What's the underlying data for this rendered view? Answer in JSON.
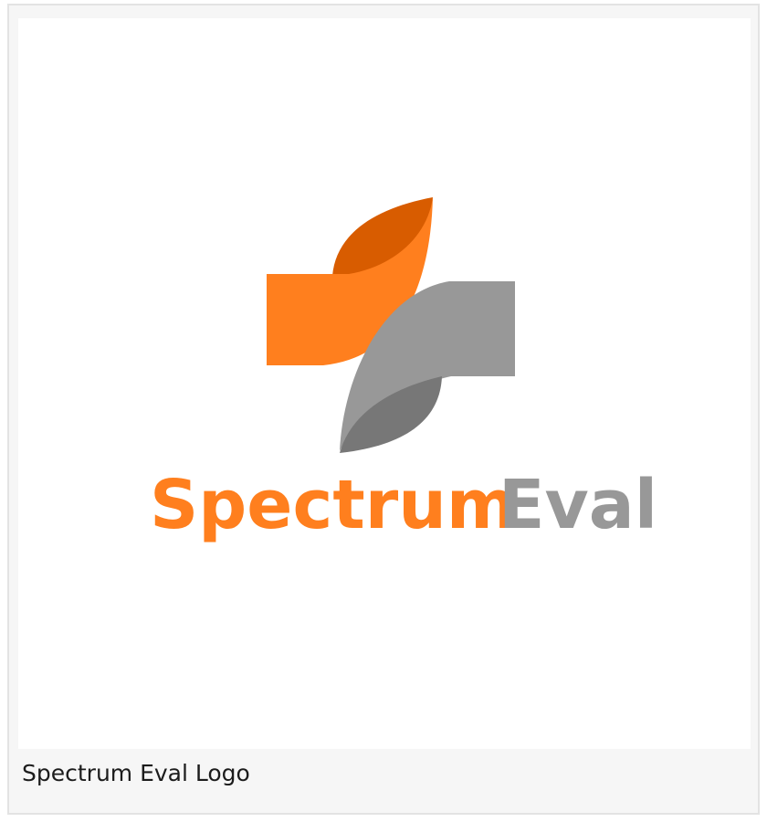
{
  "logo": {
    "word_primary": "Spectrum",
    "word_secondary": "Eval",
    "colors": {
      "orange": "#ff7f1e",
      "orange_dark": "#d85c00",
      "gray": "#989898",
      "gray_dark": "#777777"
    }
  },
  "caption": "Spectrum Eval Logo"
}
